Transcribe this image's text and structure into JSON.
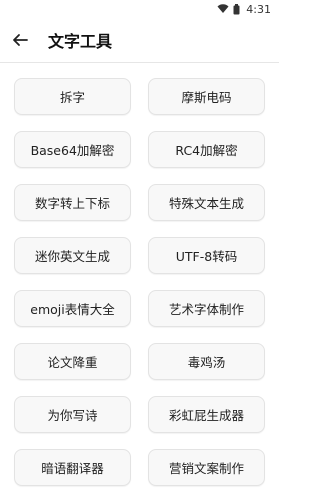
{
  "status_bar": {
    "time": "4:31"
  },
  "app_bar": {
    "title": "文字工具"
  },
  "tools": [
    "拆字",
    "摩斯电码",
    "Base64加解密",
    "RC4加解密",
    "数字转上下标",
    "特殊文本生成",
    "迷你英文生成",
    "UTF-8转码",
    "emoji表情大全",
    "艺术字体制作",
    "论文降重",
    "毒鸡汤",
    "为你写诗",
    "彩虹屁生成器",
    "暗语翻译器",
    "营销文案制作"
  ]
}
